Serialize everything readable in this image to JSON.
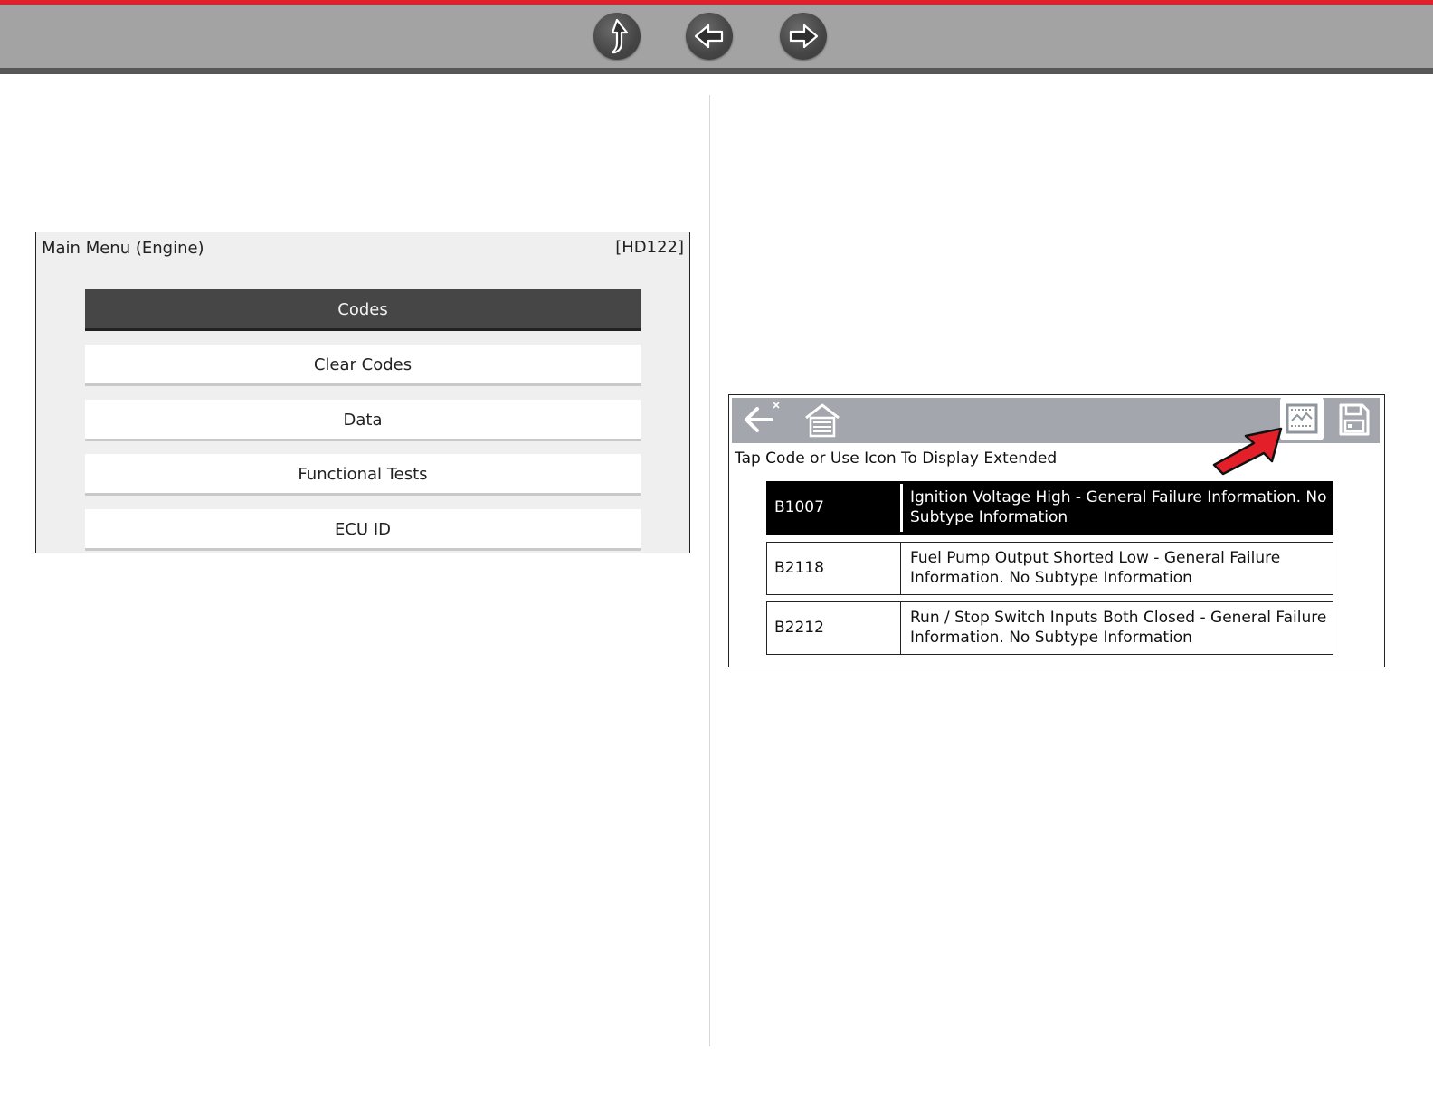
{
  "nav": {
    "buttons": [
      "up-arrow-icon",
      "back-arrow-icon",
      "forward-arrow-icon"
    ]
  },
  "menu": {
    "title": "Main Menu (Engine)",
    "id": "[HD122]",
    "items": [
      {
        "label": "Codes",
        "selected": true
      },
      {
        "label": "Clear Codes",
        "selected": false
      },
      {
        "label": "Data",
        "selected": false
      },
      {
        "label": "Functional Tests",
        "selected": false
      },
      {
        "label": "ECU ID",
        "selected": false
      }
    ]
  },
  "codes": {
    "instruction": "Tap Code or Use Icon To Display Extended",
    "toolbar_icons": [
      "back-exit-icon",
      "home-icon",
      "extended-view-icon",
      "save-icon"
    ],
    "rows": [
      {
        "code": "B1007",
        "description": "Ignition Voltage High - General Failure Information. No Subtype Information",
        "selected": true
      },
      {
        "code": "B2118",
        "description": "Fuel Pump Output Shorted Low - General Failure Information. No Subtype Information",
        "selected": false
      },
      {
        "code": "B2212",
        "description": "Run / Stop Switch Inputs Both Closed - General Failure Information. No Subtype Information",
        "selected": false
      }
    ]
  },
  "colors": {
    "accent_red": "#e3202a",
    "nav_bar": "#a3a3a3",
    "menu_selected": "#464646",
    "toolbar": "#a3a7ad"
  }
}
